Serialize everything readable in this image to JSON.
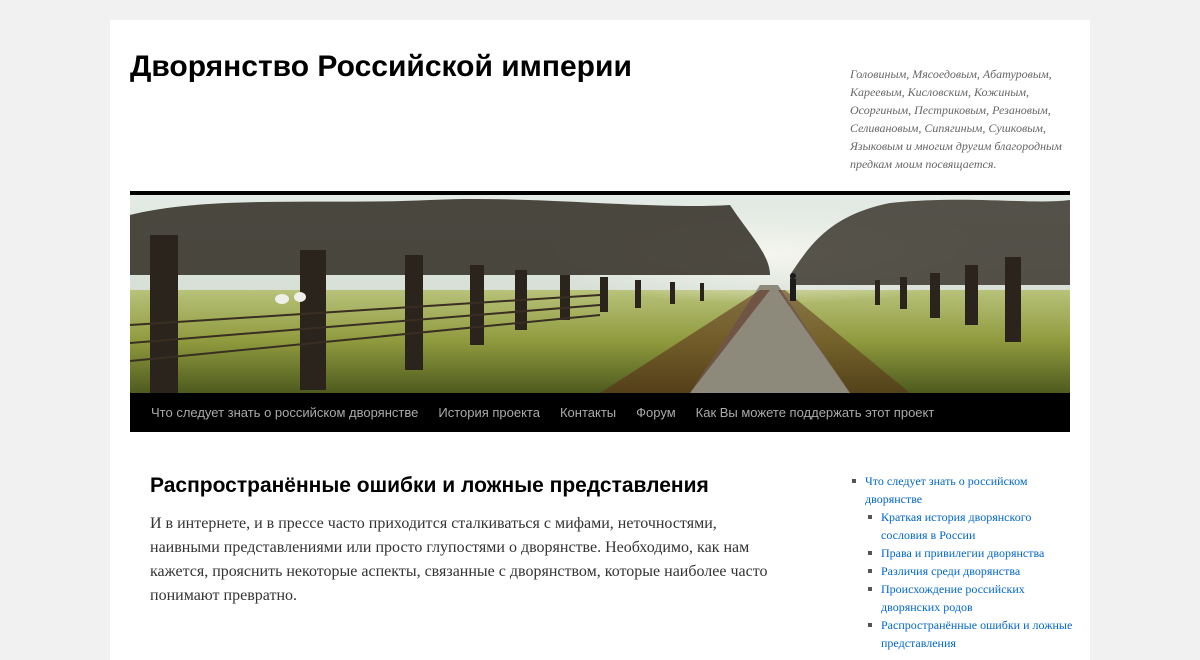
{
  "header": {
    "site_title": "Дворянство Российской империи",
    "site_description": "Головиным, Мясоедовым, Абатуровым, Кареевым, Кисловским, Кожиным, Осоргиным, Пестриковым, Резановым, Селивановым, Сипягиным, Сушковым, Языковым и многим другим благородным предкам моим посвящается."
  },
  "nav": {
    "items": [
      {
        "label": "Что следует знать о российском дворянстве"
      },
      {
        "label": "История проекта"
      },
      {
        "label": "Контакты"
      },
      {
        "label": "Форум"
      },
      {
        "label": "Как Вы можете поддержать этот проект"
      }
    ]
  },
  "article": {
    "title": "Распространённые ошибки и ложные представления",
    "text": "И в интернете, и в прессе часто приходится сталкиваться с мифами, неточностями, наивными представлениями или просто глупостями о дворянстве. Необходимо, как нам кажется, прояснить некоторые аспекты, связанные с дворянством, которые наиболее часто понимают превратно."
  },
  "sidebar": {
    "parent": {
      "label": "Что следует знать о российском дворянстве"
    },
    "children": [
      {
        "label": "Краткая история дворянского сословия в России"
      },
      {
        "label": "Права и привилегии дворянства"
      },
      {
        "label": "Различия среди дворянства"
      },
      {
        "label": "Происхождение российских дворянских родов"
      },
      {
        "label": "Распространённые ошибки и ложные представления"
      }
    ]
  },
  "colors": {
    "background": "#f1f1f1",
    "nav_background": "#000000",
    "nav_text": "#aaaaaa",
    "link": "#0066cc"
  },
  "icons": {
    "banner": "tree-lined-avenue-photo"
  }
}
